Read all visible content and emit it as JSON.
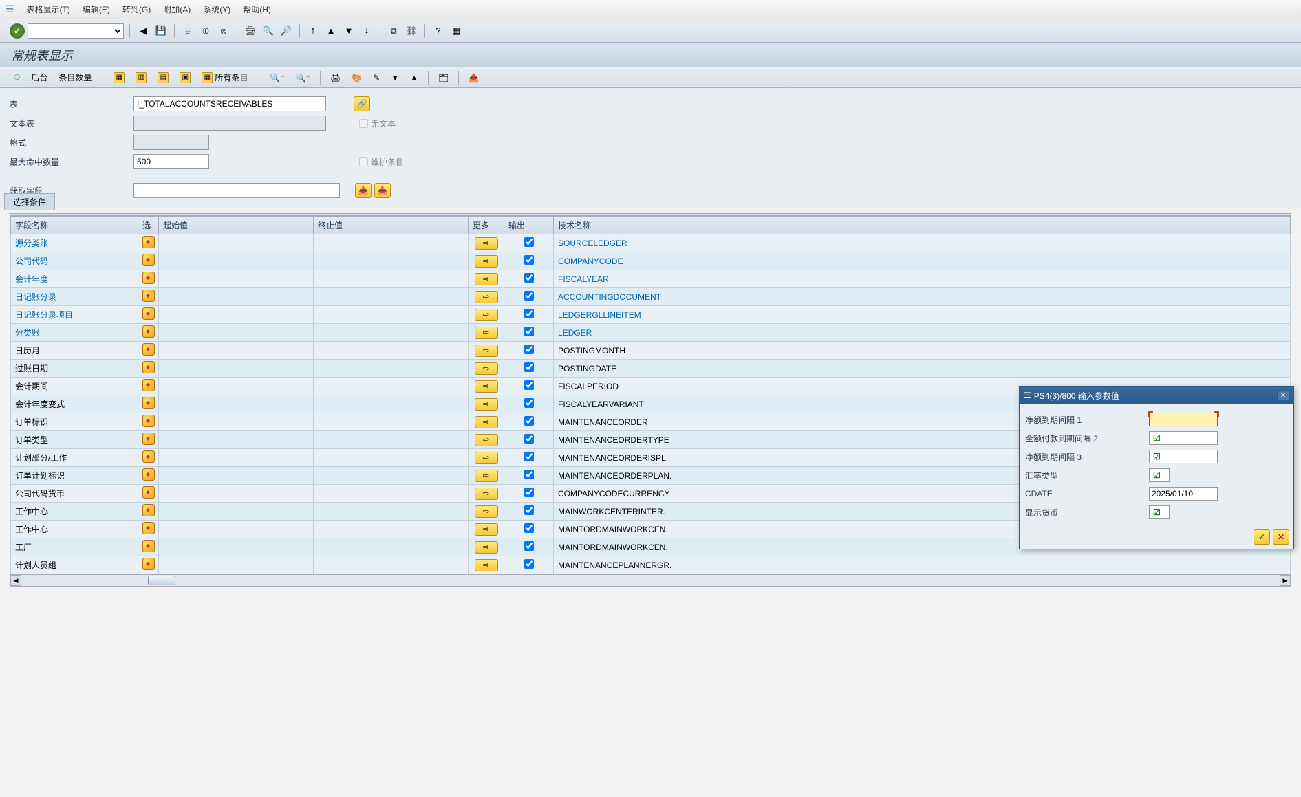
{
  "menu": {
    "items": [
      "表格显示(T)",
      "编辑(E)",
      "转到(G)",
      "附加(A)",
      "系统(Y)",
      "帮助(H)"
    ]
  },
  "title": "常规表显示",
  "subtoolbar": {
    "background_label": "后台",
    "entry_count_label": "条目数量",
    "all_entries_label": "所有条目"
  },
  "form": {
    "table_label": "表",
    "table_value": "I_TOTALACCOUNTSRECEIVABLES",
    "text_table_label": "文本表",
    "text_table_value": "",
    "no_text_label": "无文本",
    "format_label": "格式",
    "format_value": "",
    "max_hits_label": "最大命中数量",
    "max_hits_value": "500",
    "maintain_label": "维护条目",
    "get_fields_label": "获取字段",
    "get_fields_value": ""
  },
  "selection_tab": "选择条件",
  "grid": {
    "headers": {
      "field": "字段名称",
      "sel": "选.",
      "start": "起始值",
      "end": "终止值",
      "more": "更多",
      "output": "输出",
      "tech": "技术名称"
    },
    "rows": [
      {
        "field": "源分类账",
        "link": true,
        "tech": "SOURCELEDGER",
        "techlink": true
      },
      {
        "field": "公司代码",
        "link": true,
        "tech": "COMPANYCODE",
        "techlink": true
      },
      {
        "field": "会计年度",
        "link": true,
        "tech": "FISCALYEAR",
        "techlink": true
      },
      {
        "field": "日记账分录",
        "link": true,
        "tech": "ACCOUNTINGDOCUMENT",
        "techlink": true
      },
      {
        "field": "日记账分录项目",
        "link": true,
        "tech": "LEDGERGLLINEITEM",
        "techlink": true
      },
      {
        "field": "分类账",
        "link": true,
        "tech": "LEDGER",
        "techlink": true
      },
      {
        "field": "日历月",
        "link": false,
        "tech": "POSTINGMONTH",
        "techlink": false
      },
      {
        "field": "过账日期",
        "link": false,
        "tech": "POSTINGDATE",
        "techlink": false
      },
      {
        "field": "会计期间",
        "link": false,
        "tech": "FISCALPERIOD",
        "techlink": false
      },
      {
        "field": "会计年度变式",
        "link": false,
        "tech": "FISCALYEARVARIANT",
        "techlink": false
      },
      {
        "field": "订单标识",
        "link": false,
        "tech": "MAINTENANCEORDER",
        "techlink": false
      },
      {
        "field": "订单类型",
        "link": false,
        "tech": "MAINTENANCEORDERTYPE",
        "techlink": false
      },
      {
        "field": "计划部分/工作",
        "link": false,
        "tech": "MAINTENANCEORDERISPL.",
        "techlink": false
      },
      {
        "field": "订单计划标识",
        "link": false,
        "tech": "MAINTENANCEORDERPLAN.",
        "techlink": false
      },
      {
        "field": "公司代码货币",
        "link": false,
        "tech": "COMPANYCODECURRENCY",
        "techlink": false
      },
      {
        "field": "工作中心",
        "link": false,
        "tech": "MAINWORKCENTERINTER.",
        "techlink": false
      },
      {
        "field": "工作中心",
        "link": false,
        "tech": "MAINTORDMAINWORKCEN.",
        "techlink": false
      },
      {
        "field": "工厂",
        "link": false,
        "tech": "MAINTORDMAINWORKCEN.",
        "techlink": false
      },
      {
        "field": "计划人员组",
        "link": false,
        "tech": "MAINTENANCEPLANNERGR.",
        "techlink": false
      }
    ]
  },
  "dialog": {
    "title": "PS4(3)/800 输入参数值",
    "rows": [
      {
        "label": "净额到期间隔 1",
        "value": "",
        "required": true,
        "tick": false
      },
      {
        "label": "全额付款到期间隔 2",
        "value": "",
        "required": false,
        "tick": true
      },
      {
        "label": "净额到期间隔 3",
        "value": "",
        "required": false,
        "tick": true
      },
      {
        "label": "汇率类型",
        "value": "",
        "required": false,
        "tick": true,
        "small": true
      },
      {
        "label": "CDATE",
        "value": "2025/01/10",
        "required": false,
        "tick": false
      },
      {
        "label": "显示货币",
        "value": "",
        "required": false,
        "tick": true,
        "small": true
      }
    ]
  }
}
